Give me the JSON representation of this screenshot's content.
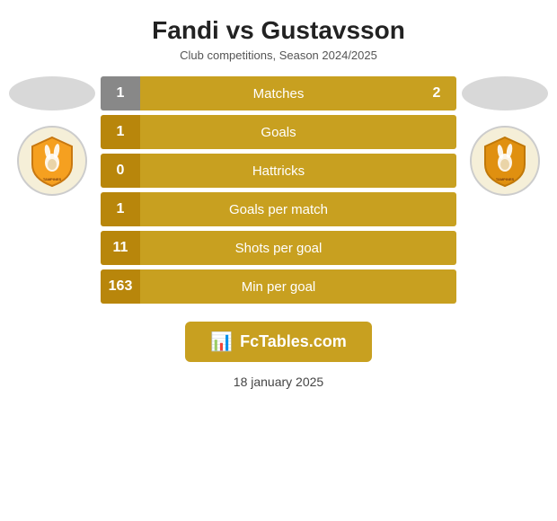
{
  "header": {
    "title": "Fandi vs Gustavsson",
    "subtitle": "Club competitions, Season 2024/2025"
  },
  "stats": [
    {
      "label": "Matches",
      "left": "1",
      "right": "2",
      "rowType": "matches"
    },
    {
      "label": "Goals",
      "left": "1",
      "right": "",
      "rowType": "normal"
    },
    {
      "label": "Hattricks",
      "left": "0",
      "right": "",
      "rowType": "normal"
    },
    {
      "label": "Goals per match",
      "left": "1",
      "right": "",
      "rowType": "normal"
    },
    {
      "label": "Shots per goal",
      "left": "11",
      "right": "",
      "rowType": "normal"
    },
    {
      "label": "Min per goal",
      "left": "163",
      "right": "",
      "rowType": "normal"
    }
  ],
  "badge": {
    "text": "FcTables.com",
    "icon": "📊"
  },
  "date": "18 january 2025",
  "colors": {
    "gold": "#c8a020",
    "dark_gold": "#b8860b",
    "gray": "#888888",
    "white": "#ffffff"
  }
}
